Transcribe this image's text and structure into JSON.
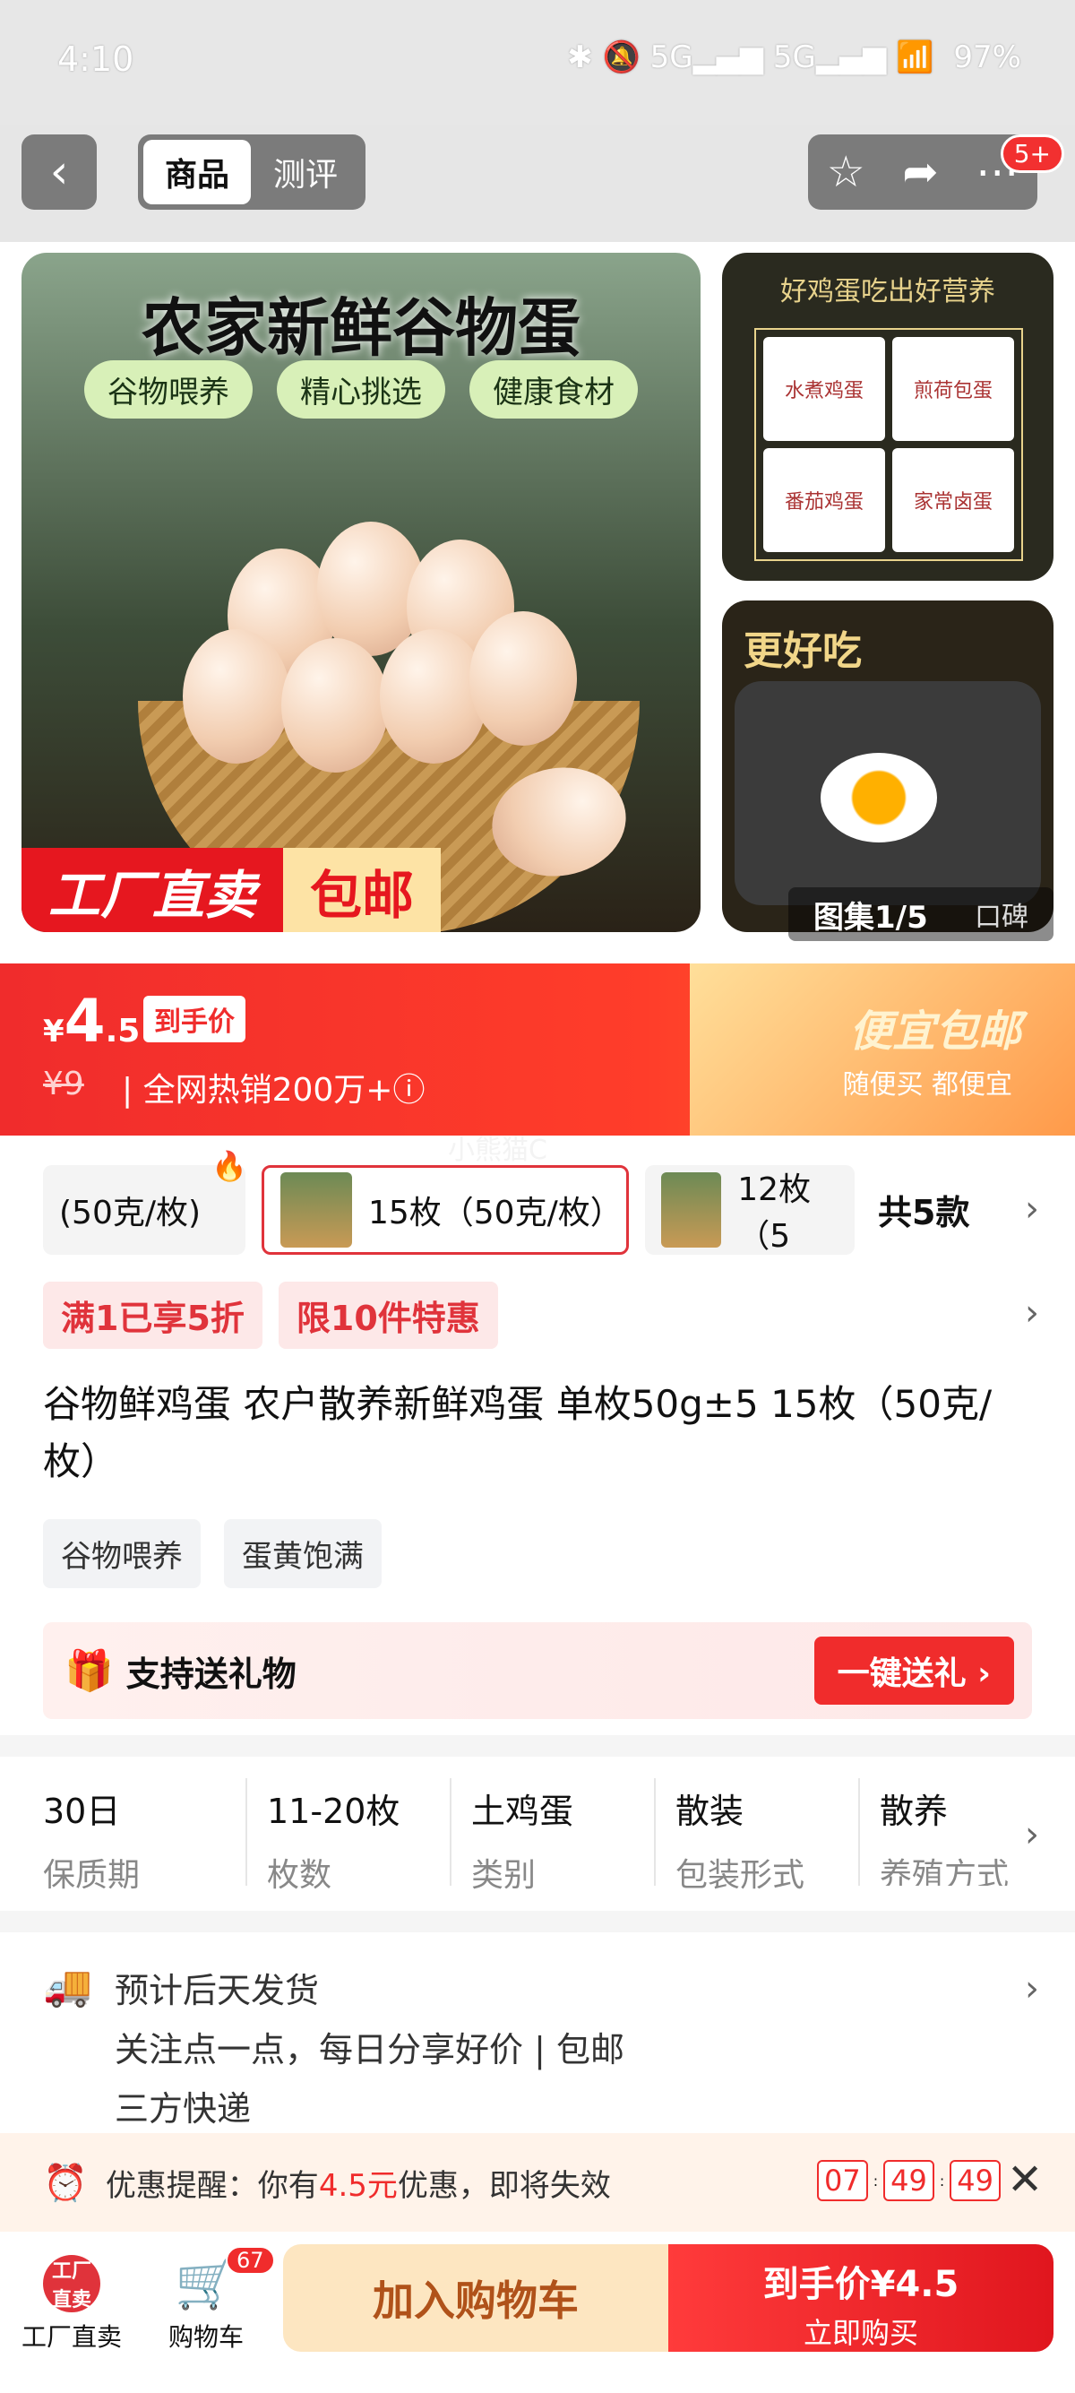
{
  "status_bar": {
    "time": "4:10",
    "icons": "✱ 🔕 5G▂▄▆ 5G▂▄▆ 📶",
    "battery": "97%"
  },
  "header": {
    "tab_product": "商品",
    "tab_review": "测评",
    "more_badge": "5+"
  },
  "gallery": {
    "main_title": "农家新鲜谷物蛋",
    "chips": [
      "谷物喂养",
      "精心挑选",
      "健康食材"
    ],
    "factory_direct": "工厂直卖",
    "free_shipping": "包邮",
    "side1_title": "好鸡蛋吃出好营养",
    "side1_cells": [
      "水煮鸡蛋",
      "煎荷包蛋",
      "番茄鸡蛋",
      "家常卤蛋"
    ],
    "side2_title": "更好吃",
    "counter": "图集1/5",
    "reputation": "口碑"
  },
  "price": {
    "currency": "¥",
    "int": "4",
    "dec": ".5",
    "tag": "到手价",
    "original": "¥9",
    "sold": "| 全网热销200万+ⓘ",
    "right_title": "便宜包邮",
    "right_sub": "随便买 都便宜"
  },
  "watermark": "小熊猫C",
  "sku": {
    "items": [
      "(50克/枚)",
      "15枚（50克/枚）",
      "12枚（5"
    ],
    "total": "共5款"
  },
  "promos": [
    "满1已享5折",
    "限10件特惠"
  ],
  "product_title": "谷物鲜鸡蛋 农户散养新鲜鸡蛋 单枚50g±5 15枚（50克/枚）",
  "attrs": [
    "谷物喂养",
    "蛋黄饱满"
  ],
  "gift": {
    "text": "支持送礼物",
    "button": "一键送礼 ›"
  },
  "specs": [
    {
      "value": "30日",
      "key": "保质期"
    },
    {
      "value": "11-20枚",
      "key": "枚数"
    },
    {
      "value": "土鸡蛋",
      "key": "类别"
    },
    {
      "value": "散装",
      "key": "包装形式"
    },
    {
      "value": "散养",
      "key": "养殖方式"
    }
  ],
  "shipping": {
    "line1": "预计后天发货",
    "line2": "关注点一点，每日分享好价 | 包邮",
    "line3": "三方快递"
  },
  "reminder": {
    "prefix": "优惠提醒：你有",
    "amount": "4.5元",
    "suffix": "优惠，即将失效",
    "h": "07",
    "m": "49",
    "s": "49"
  },
  "bottom": {
    "factory_icon": "工厂直卖",
    "factory_label": "工厂直卖",
    "cart_label": "购物车",
    "cart_badge": "67",
    "add_cart": "加入购物车",
    "buy_price": "到手价¥4.5",
    "buy_now": "立即购买"
  }
}
